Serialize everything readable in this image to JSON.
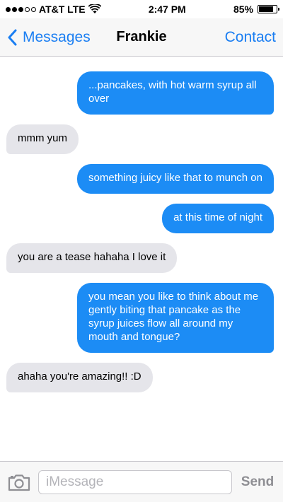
{
  "status_bar": {
    "carrier": "AT&T LTE",
    "time": "2:47 PM",
    "battery_percent": "85%",
    "battery_level": 0.85,
    "signal_bars_filled": 3,
    "signal_bars_total": 5
  },
  "nav": {
    "back_label": "Messages",
    "title": "Frankie",
    "contact_label": "Contact"
  },
  "messages": [
    {
      "direction": "out",
      "text": "...pancakes, with hot warm syrup all over"
    },
    {
      "direction": "in",
      "text": "mmm yum"
    },
    {
      "direction": "out",
      "text": "something juicy like that to munch on"
    },
    {
      "direction": "out",
      "text": "at this time of night"
    },
    {
      "direction": "in",
      "text": "you are a tease hahaha I love it"
    },
    {
      "direction": "out",
      "text": "you mean you like to think about me gently biting that pancake as the syrup juices flow all around my mouth and tongue?"
    },
    {
      "direction": "in",
      "text": "ahaha you're amazing!! :D"
    }
  ],
  "composer": {
    "placeholder": "iMessage",
    "value": "",
    "send_label": "Send"
  },
  "colors": {
    "accent": "#1a7ef2",
    "outgoing_bubble": "#1c8cf5",
    "incoming_bubble": "#e5e5ea"
  },
  "icons": {
    "back": "chevron-left-icon",
    "camera": "camera-icon",
    "wifi": "wifi-icon",
    "battery": "battery-icon"
  }
}
